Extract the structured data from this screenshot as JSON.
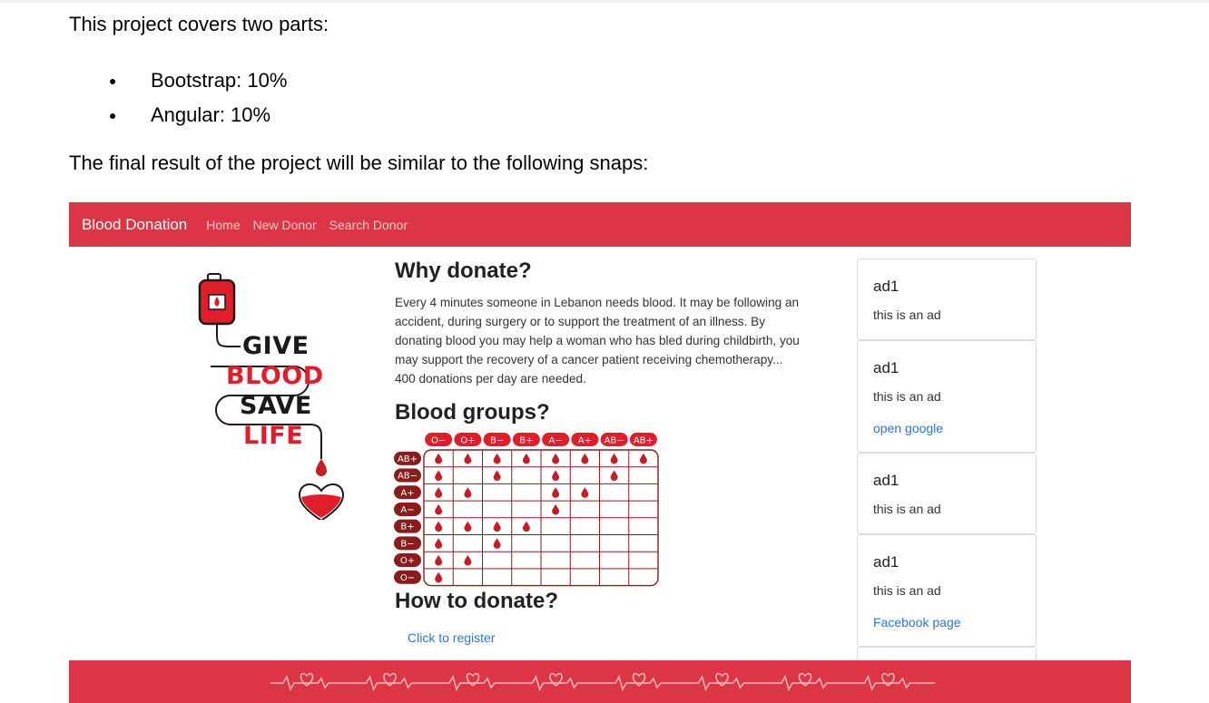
{
  "document": {
    "intro": "This project covers two parts:",
    "list": [
      {
        "text": "Bootstrap: 10%"
      },
      {
        "text": "Angular: 10%"
      }
    ],
    "outro": "The final result of the project will be similar to the following snaps:"
  },
  "navbar": {
    "brand": "Blood Donation",
    "links": [
      "Home",
      "New Donor",
      "Search Donor"
    ],
    "color": "#dc3545"
  },
  "poster": {
    "words": [
      "GIVE",
      "BLOOD",
      "SAVE",
      "LIFE"
    ],
    "dark_color": "#1a1a1a",
    "red_color": "#e21d2a"
  },
  "why": {
    "heading": "Why donate?",
    "text": "Every 4 minutes someone in Lebanon needs blood. It may be following an accident, during surgery or to support the treatment of an illness. By donating blood you may help a woman who has bled during childbirth, you may support the recovery of a cancer patient receiving chemotherapy... 400 donations per day are needed."
  },
  "blood_groups": {
    "heading": "Blood groups?",
    "donors": [
      "O−",
      "O+",
      "B−",
      "B+",
      "A−",
      "A+",
      "AB−",
      "AB+"
    ],
    "recipients": [
      "AB+",
      "AB−",
      "A+",
      "A−",
      "B+",
      "B−",
      "O+",
      "O−"
    ],
    "compatible": [
      [
        1,
        1,
        1,
        1,
        1,
        1,
        1,
        1
      ],
      [
        1,
        0,
        1,
        0,
        1,
        0,
        1,
        0
      ],
      [
        1,
        1,
        0,
        0,
        1,
        1,
        0,
        0
      ],
      [
        1,
        0,
        0,
        0,
        1,
        0,
        0,
        0
      ],
      [
        1,
        1,
        1,
        1,
        0,
        0,
        0,
        0
      ],
      [
        1,
        0,
        1,
        0,
        0,
        0,
        0,
        0
      ],
      [
        1,
        1,
        0,
        0,
        0,
        0,
        0,
        0
      ],
      [
        1,
        0,
        0,
        0,
        0,
        0,
        0,
        0
      ]
    ],
    "header_color": "#e21d2a",
    "row_color": "#8b1c1c",
    "drop_color": "#c41e24"
  },
  "how": {
    "heading": "How to donate?",
    "link": "Click to register"
  },
  "ads": [
    {
      "title": "ad1",
      "text": "this is an ad",
      "link": ""
    },
    {
      "title": "ad1",
      "text": "this is an ad",
      "link": "open google"
    },
    {
      "title": "ad1",
      "text": "this is an ad",
      "link": ""
    },
    {
      "title": "ad1",
      "text": "this is an ad",
      "link": "Facebook page"
    }
  ],
  "footer": {
    "color": "#dc3545",
    "line_color": "#f5b5bb",
    "icons": [
      "heart-icon",
      "heartbeat-line"
    ]
  }
}
